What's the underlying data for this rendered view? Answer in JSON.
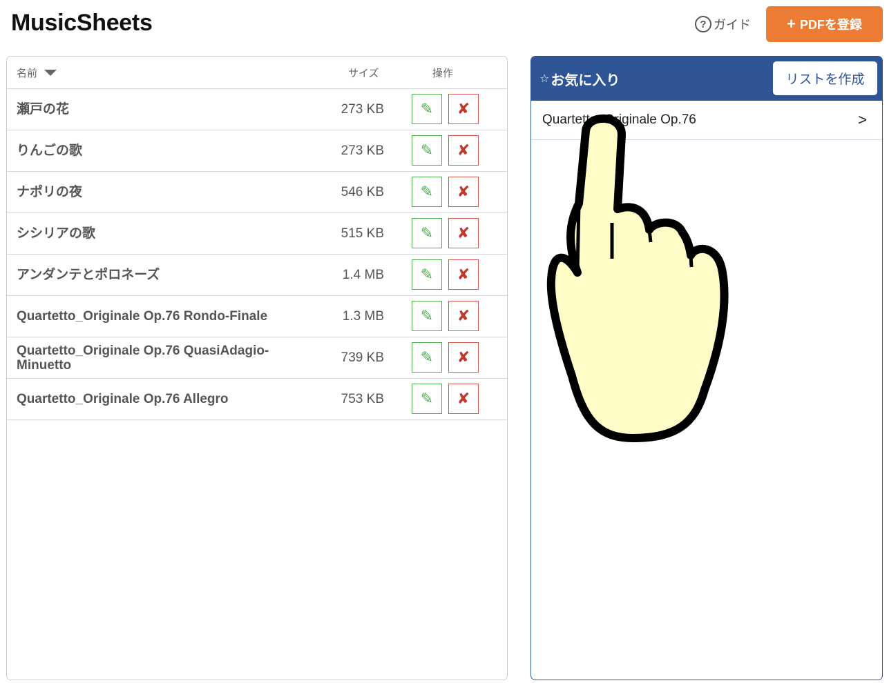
{
  "app": {
    "title": "MusicSheets"
  },
  "header": {
    "guide_label": "ガイド",
    "guide_icon": "?",
    "register_plus": "+",
    "register_label": "PDFを登録",
    "accent_color": "#ec7c34"
  },
  "file_table": {
    "columns": {
      "name": "名前",
      "size": "サイズ",
      "ops": "操作"
    },
    "sort": "name-descending",
    "edit_icon": "✎",
    "delete_icon": "✘",
    "rows": [
      {
        "name": "瀬戸の花",
        "size": "273 KB"
      },
      {
        "name": "りんごの歌",
        "size": "273 KB"
      },
      {
        "name": "ナポリの夜",
        "size": "546 KB"
      },
      {
        "name": "シシリアの歌",
        "size": "515 KB"
      },
      {
        "name": "アンダンテとポロネーズ",
        "size": "1.4 MB"
      },
      {
        "name": "Quartetto_Originale Op.76 Rondo-Finale",
        "size": "1.3 MB"
      },
      {
        "name": "Quartetto_Originale Op.76 QuasiAdagio-Minuetto",
        "size": "739 KB"
      },
      {
        "name": "Quartetto_Originale Op.76 Allegro",
        "size": "753 KB"
      }
    ]
  },
  "favorites": {
    "title_icon": "☆",
    "title": "お気に入り",
    "create_list_label": "リストを作成",
    "header_color": "#2f5597",
    "items": [
      {
        "label": "Quartetto_Originale Op.76",
        "chevron": ">"
      }
    ]
  },
  "overlay": {
    "pointer": "pointing-hand-icon"
  }
}
